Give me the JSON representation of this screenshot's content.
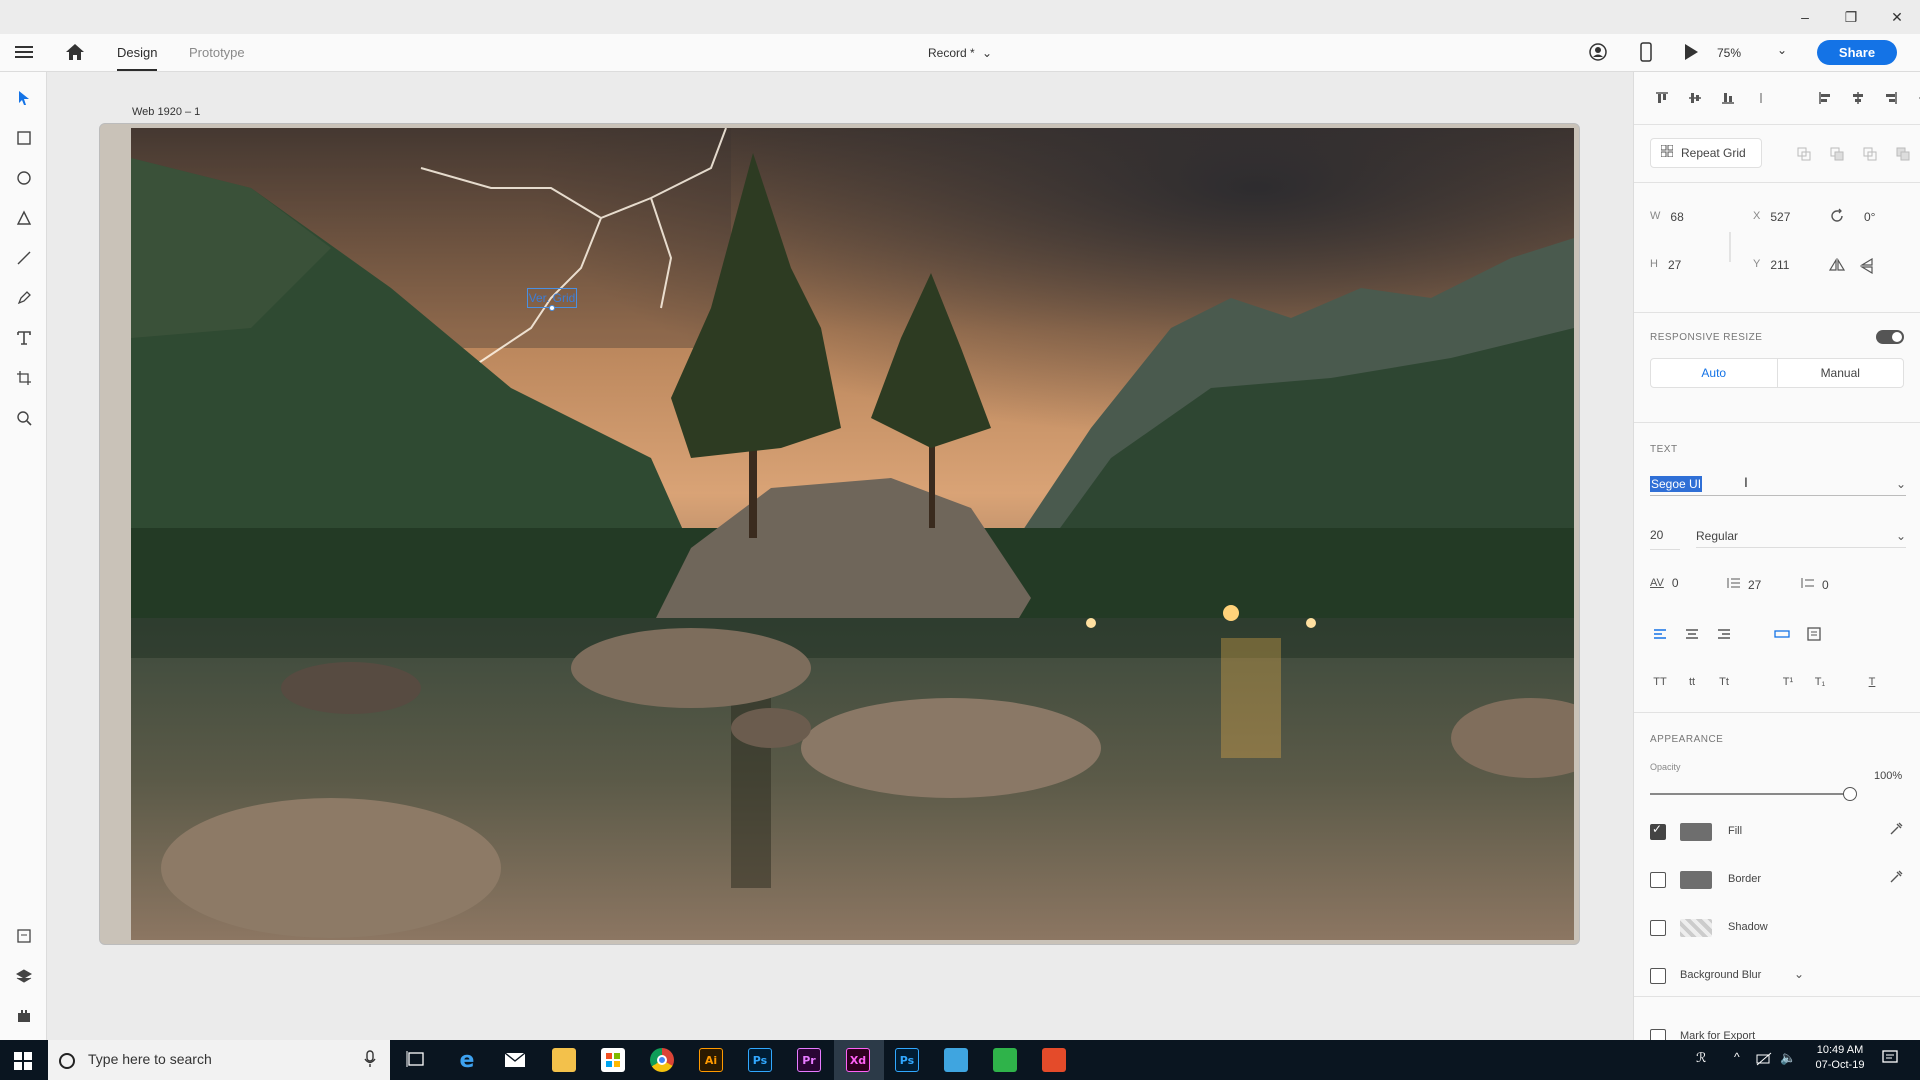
{
  "window": {
    "minimize_glyph": "–",
    "restore_glyph": "❐",
    "close_glyph": "✕"
  },
  "topbar": {
    "tabs": [
      {
        "label": "Design"
      },
      {
        "label": "Prototype"
      }
    ],
    "doc_title": "Record *",
    "zoom": "75%",
    "share_label": "Share"
  },
  "canvas": {
    "artboard_label": "Web 1920 – 1",
    "selected_text": "Ver. Grid"
  },
  "panel": {
    "repeat_grid_label": "Repeat Grid",
    "transform": {
      "w_label": "W",
      "w": "68",
      "x_label": "X",
      "x": "527",
      "rotation": "0°",
      "h_label": "H",
      "h": "27",
      "y_label": "Y",
      "y": "211"
    },
    "responsive_resize": {
      "title": "RESPONSIVE RESIZE",
      "enabled": true,
      "auto": "Auto",
      "manual": "Manual"
    },
    "text": {
      "title": "TEXT",
      "font_family": "Segoe UI",
      "font_size": "20",
      "font_weight": "Regular",
      "char_spacing": "0",
      "line_spacing": "27",
      "para_spacing": "0"
    },
    "appearance": {
      "title": "APPEARANCE",
      "opacity_label": "Opacity",
      "opacity": "100%",
      "opacity_fraction": 1.0,
      "fill_label": "Fill",
      "fill_checked": true,
      "fill_color": "#6e6e6e",
      "border_label": "Border",
      "border_checked": false,
      "border_color": "#6e6e6e",
      "shadow_label": "Shadow",
      "shadow_checked": false,
      "blur_label": "Background Blur",
      "blur_checked": false,
      "export_label": "Mark for Export"
    }
  },
  "taskbar": {
    "search_placeholder": "Type here to search",
    "apps": [
      "Ai",
      "Ps",
      "Pr",
      "Xd",
      "Ps"
    ],
    "time": "10:49 AM",
    "date": "07-Oct-19"
  },
  "colors": {
    "accent": "#1473e6",
    "taskbar": "#0a1520",
    "panel": "#fafafa"
  }
}
